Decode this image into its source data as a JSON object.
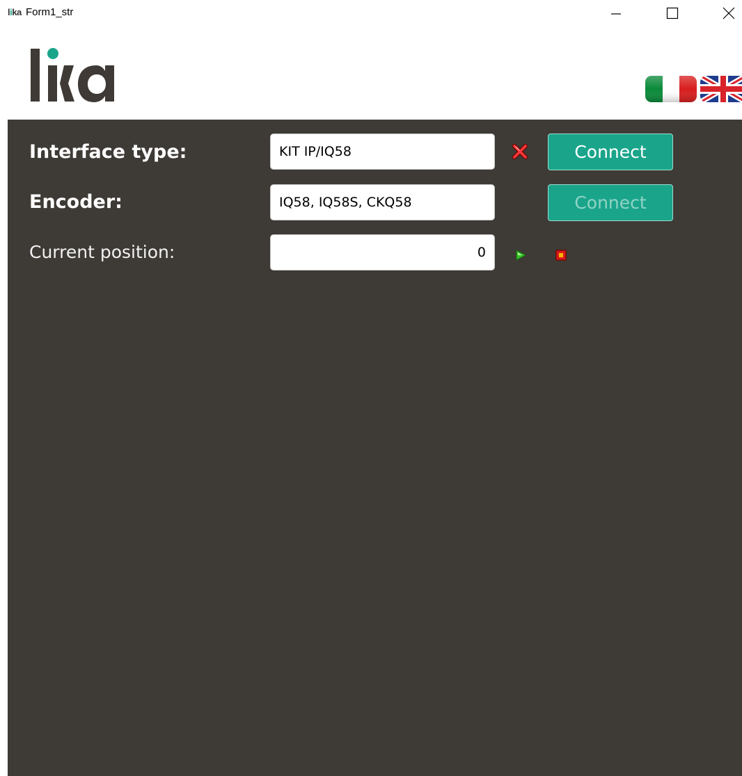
{
  "window": {
    "title": "Form1_str",
    "app_icon_text": "lika",
    "controls": {
      "minimize": "minimize-icon",
      "maximize": "maximize-icon",
      "close": "close-icon"
    }
  },
  "header": {
    "logo_text": "lika",
    "languages": [
      {
        "name": "Italian",
        "icon": "flag-italy-icon"
      },
      {
        "name": "English",
        "icon": "flag-uk-icon"
      }
    ]
  },
  "form": {
    "interface_type": {
      "label": "Interface type:",
      "value": "KIT IP/IQ58",
      "status_icon": "red-x-icon",
      "button_label": "Connect"
    },
    "encoder": {
      "label": "Encoder:",
      "value": "IQ58, IQ58S, CKQ58",
      "button_label": "Connect"
    },
    "current_position": {
      "label": "Current position:",
      "value": "0",
      "start_icon": "play-icon",
      "stop_icon": "stop-icon"
    }
  },
  "colors": {
    "brand_green": "#1aa58b",
    "panel_background": "#3e3a35",
    "logo_dark": "#3f3a35"
  }
}
